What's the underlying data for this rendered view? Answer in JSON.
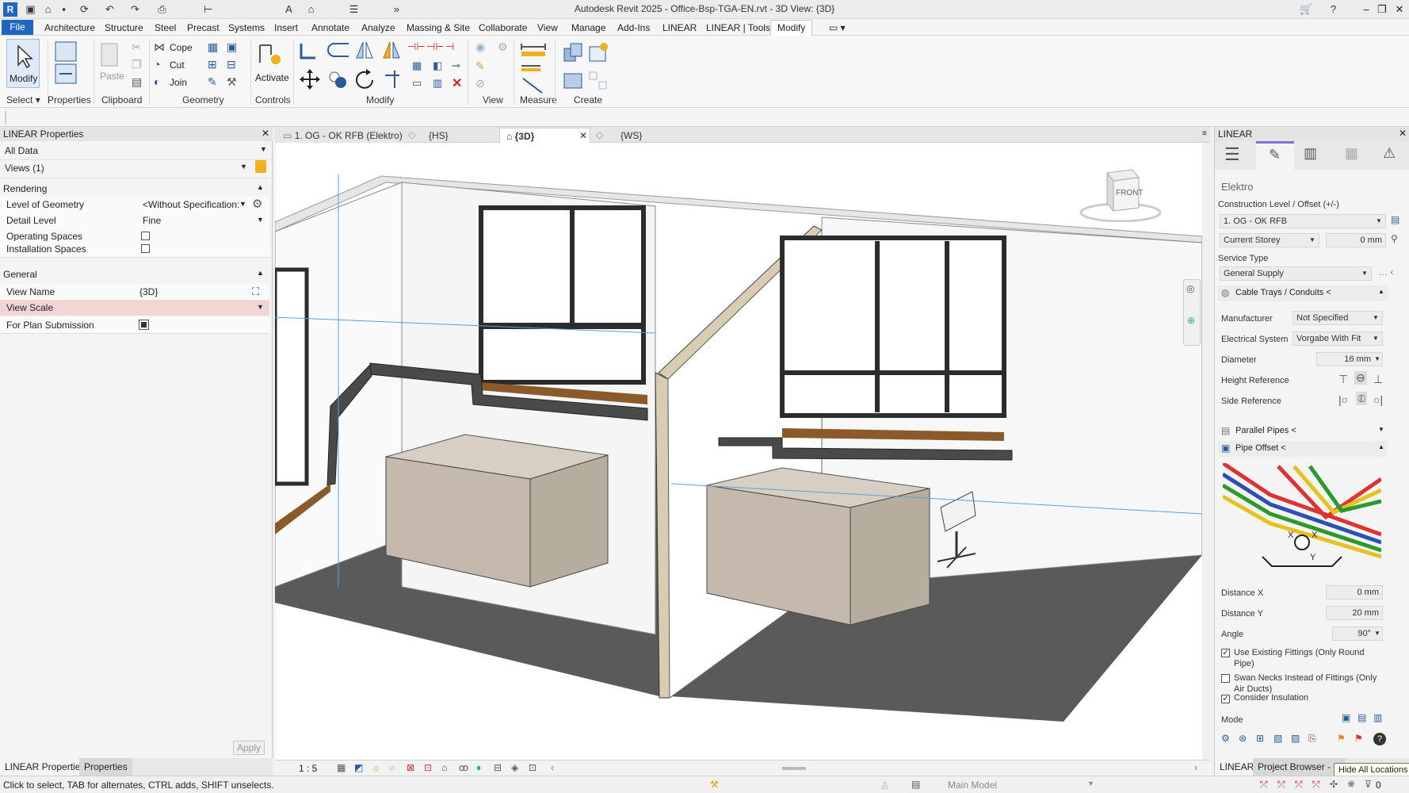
{
  "window": {
    "title": "Autodesk Revit 2025 - Office-Bsp-TGA-EN.rvt - 3D View: {3D}"
  },
  "menu": {
    "file": "File",
    "items": [
      "Architecture",
      "Structure",
      "Steel",
      "Precast",
      "Systems",
      "Insert",
      "Annotate",
      "Analyze",
      "Massing & Site",
      "Collaborate",
      "View",
      "Manage",
      "Add-Ins",
      "LINEAR",
      "LINEAR | Tools"
    ],
    "active": "Modify"
  },
  "ribbon": {
    "modify_label": "Modify",
    "properties_label": "Properties",
    "paste_label": "Paste",
    "cope_label": "Cope",
    "cut_label": "Cut",
    "join_label": "Join",
    "activate_label": "Activate",
    "groups": [
      "Select",
      "Properties",
      "Clipboard",
      "Geometry",
      "Controls",
      "Modify",
      "View",
      "Measure",
      "Create"
    ]
  },
  "left_panel": {
    "title": "LINEAR Properties",
    "filter": "All Data",
    "views": "Views (1)",
    "rendering_header": "Rendering",
    "level_of_geometry_label": "Level of Geometry",
    "level_of_geometry_value": "<Without Specification:",
    "detail_level_label": "Detail Level",
    "detail_level_value": "Fine",
    "operating_spaces_label": "Operating Spaces",
    "installation_spaces_label": "Installation Spaces",
    "general_header": "General",
    "view_name_label": "View Name",
    "view_name_value": "{3D}",
    "view_scale_label": "View Scale",
    "plan_submission_label": "For Plan Submission",
    "apply": "Apply",
    "tab1": "LINEAR Properties",
    "tab2": "Properties"
  },
  "view_tabs": [
    {
      "label": "1. OG - OK RFB (Elektro)"
    },
    {
      "label": "{HS}"
    },
    {
      "label": "{3D}"
    },
    {
      "label": "{WS}"
    }
  ],
  "viewcube": {
    "label": "FRONT"
  },
  "view_bar": {
    "scale": "1 : 5"
  },
  "right_panel": {
    "title": "LINEAR",
    "section": "Elektro",
    "construction_level_label": "Construction Level / Offset (+/-)",
    "level_value": "1. OG - OK RFB",
    "storey_value": "Current Storey",
    "offset_value": "0 mm",
    "service_type_label": "Service Type",
    "service_type_value": "General Supply",
    "cable_trays_label": "Cable Trays / Conduits <",
    "manufacturer_label": "Manufacturer",
    "manufacturer_value": "Not Specified",
    "electrical_system_label": "Electrical System",
    "electrical_system_value": "Vorgabe With Fit",
    "diameter_label": "Diameter",
    "diameter_value": "16 mm",
    "height_reference_label": "Height Reference",
    "side_reference_label": "Side Reference",
    "parallel_pipes_label": "Parallel Pipes <",
    "pipe_offset_label": "Pipe Offset <",
    "distance_x_label": "Distance X",
    "distance_x_value": "0 mm",
    "distance_y_label": "Distance Y",
    "distance_y_value": "20 mm",
    "angle_label": "Angle",
    "angle_value": "90°",
    "use_existing_fittings": "Use Existing Fittings (Only Round Pipe)",
    "swan_necks": "Swan Necks Instead of Fittings (Only Air Ducts)",
    "consider_insulation": "Consider Insulation",
    "mode_label": "Mode",
    "tab1": "LINEAR",
    "tab2": "Project Browser - O",
    "tooltip": "Hide All Locations"
  },
  "status": {
    "hint": "Click to select, TAB for alternates, CTRL adds, SHIFT unselects.",
    "model": "Main Model",
    "count": "0"
  },
  "colors": {
    "file_tab": "#1f66c0",
    "floor": "#555555",
    "cabinet": "#c4b9ac",
    "sill": "#8b5a2b",
    "view_scale_highlight": "#f2d6d6"
  }
}
